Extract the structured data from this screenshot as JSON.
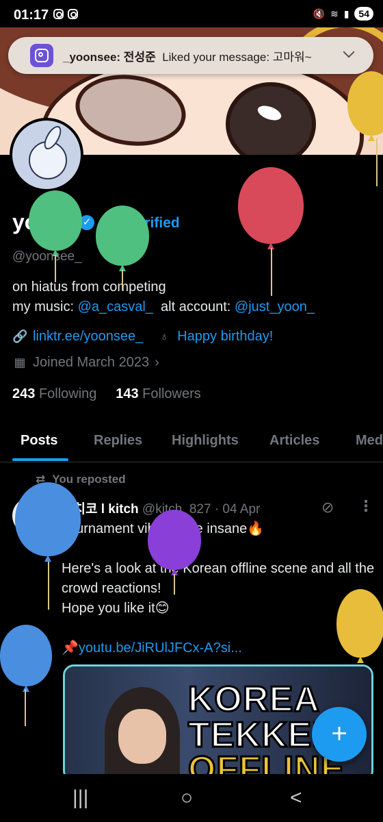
{
  "status_bar": {
    "time": "01:17",
    "battery": "54"
  },
  "notification": {
    "sender": "_yoonsee: 전성준",
    "message": "Liked your message: 고마워~"
  },
  "profile": {
    "display_name": "yoon.",
    "get_verified": "Get Verified",
    "handle": "@yoonsee_",
    "bio_line1": "on hiatus from competing",
    "bio_prefix": "my music: ",
    "bio_music_link": "@a_casval_",
    "bio_alt_label": "  alt account: ",
    "bio_alt_link": "@just_yoon_",
    "website": "linktr.ee/yoonsee_",
    "birthday": "Happy birthday!",
    "joined": "Joined March 2023",
    "following_count": "243",
    "following_label": "Following",
    "followers_count": "143",
    "followers_label": "Followers"
  },
  "tabs": [
    "Posts",
    "Replies",
    "Highlights",
    "Articles",
    "Med"
  ],
  "post": {
    "repost_label": "You reposted",
    "author_name": "키치코 l kitch",
    "author_handle": "@kitch_827",
    "date": "· 04 Apr",
    "line1": "Tournament vibes were insane🔥",
    "line2": "Here's a look at the Korean offline scene and all the crowd reactions!",
    "line3": "Hope you like it😊",
    "link": "📌youtu.be/JiRUlJFCx-A?si...",
    "media_title1": "KOREA",
    "media_title2": "TEKKEN",
    "media_title3": "OFFLINE"
  },
  "fab_label": "+",
  "nav": {
    "recents": "|||",
    "home": "○",
    "back": "<"
  },
  "colors": {
    "accent": "#1d9bf0",
    "background": "#000000"
  }
}
